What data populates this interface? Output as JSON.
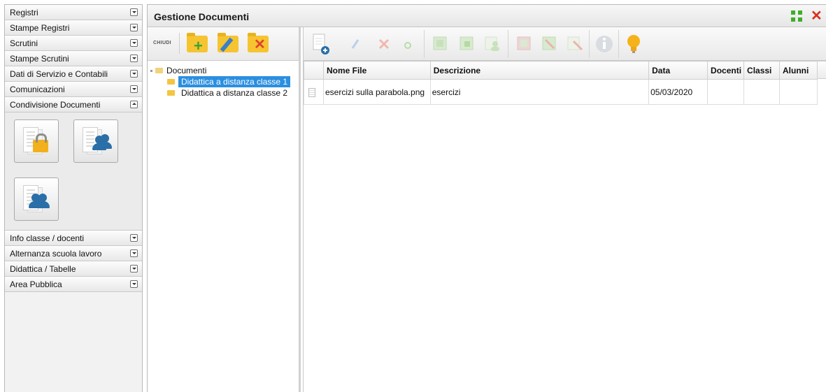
{
  "sidebar": {
    "top_items": [
      "Registri",
      "Stampe Registri",
      "Scrutini",
      "Stampe Scrutini",
      "Dati di Servizio e Contabili",
      "Comunicazioni",
      "Condivisione Documenti"
    ],
    "bottom_items": [
      "Info classe / docenti",
      "Alternanza scuola lavoro",
      "Didattica / Tabelle",
      "Area Pubblica"
    ],
    "share_buttons": [
      "private-documents-icon",
      "shared-documents-icon",
      "group-documents-icon"
    ]
  },
  "main": {
    "title": "Gestione Documenti",
    "tree_toolbar": {
      "close_label": "CHIUDI"
    },
    "tree": {
      "root": "Documenti",
      "children": [
        "Didattica a distanza classe 1",
        "Didattica a distanza classe 2"
      ],
      "selected_index": 0
    },
    "table": {
      "columns": [
        "",
        "Nome File",
        "Descrizione",
        "Data",
        "Docenti",
        "Classi",
        "Alunni"
      ],
      "rows": [
        {
          "name": "esercizi sulla parabola.png",
          "description": "esercizi",
          "date": "05/03/2020",
          "docenti": "",
          "classi": "",
          "alunni": ""
        }
      ]
    }
  },
  "colors": {
    "selected": "#2b8fe0",
    "folder": "#f6c431",
    "close": "#d8321d",
    "expand": "#3fae2a",
    "bulb": "#f6b21a"
  }
}
